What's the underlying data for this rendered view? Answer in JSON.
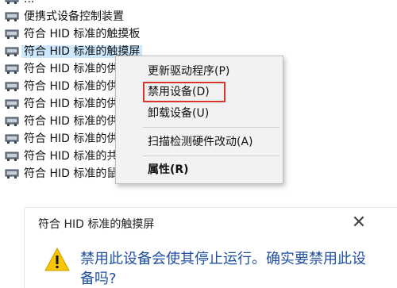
{
  "device_tree": {
    "items": [
      {
        "label": "...",
        "selected": false
      },
      {
        "label": "便携式设备控制装置",
        "selected": false
      },
      {
        "label": "符合 HID 标准的触摸板",
        "selected": false
      },
      {
        "label": "符合 HID 标准的触摸屏",
        "selected": true
      },
      {
        "label": "符合 HID 标准的供",
        "selected": false
      },
      {
        "label": "符合 HID 标准的供",
        "selected": false
      },
      {
        "label": "符合 HID 标准的供",
        "selected": false
      },
      {
        "label": "符合 HID 标准的供",
        "selected": false
      },
      {
        "label": "符合 HID 标准的供",
        "selected": false
      },
      {
        "label": "符合 HID 标准的共",
        "selected": false
      },
      {
        "label": "符合 HID 标准的鼠",
        "selected": false
      }
    ]
  },
  "context_menu": {
    "update_driver": "更新驱动程序(P)",
    "disable_device": "禁用设备(D)",
    "uninstall_device": "卸载设备(U)",
    "scan_hardware": "扫描检测硬件改动(A)",
    "properties": "属性(R)",
    "highlight_color": "#d9342b"
  },
  "dialog": {
    "title": "符合 HID 标准的触摸屏",
    "close_symbol": "✕",
    "message": "禁用此设备会使其停止运行。确实要禁用此设备吗?",
    "icon": "warning-icon",
    "message_color": "#1f4fa0"
  }
}
